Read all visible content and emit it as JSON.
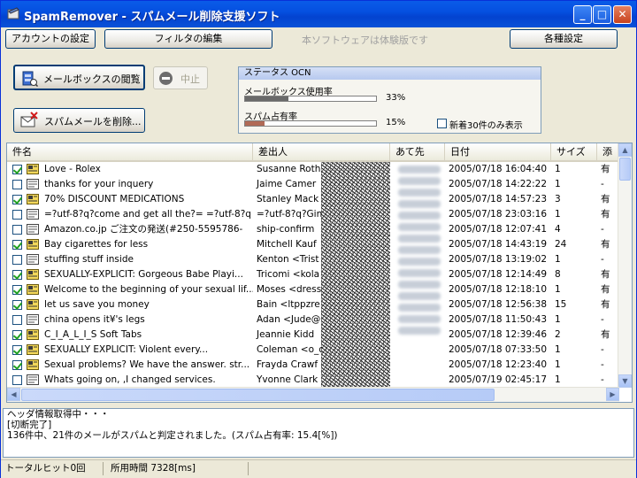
{
  "window": {
    "title": "SpamRemover - スパムメール削除支援ソフト"
  },
  "toolbar": {
    "account_settings": "アカウントの設定",
    "filter_edit": "フィルタの編集",
    "trial_note": "本ソフトウェアは体験版です",
    "settings": "各種設定",
    "browse_mailbox": "メールボックスの閲覧",
    "stop": "中止",
    "delete_spam": "スパムメールを削除..."
  },
  "status": {
    "title": "ステータス OCN",
    "mailbox_usage_label": "メールボックス使用率",
    "mailbox_usage_pct": "33%",
    "mailbox_usage_value": 33,
    "spam_ratio_label": "スパム占有率",
    "spam_ratio_pct": "15%",
    "spam_ratio_value": 15,
    "latest_only_label": "新着30件のみ表示"
  },
  "table": {
    "columns": [
      "件名",
      "差出人",
      "あて先",
      "日付",
      "サイズ",
      "添"
    ],
    "rows": [
      {
        "checked": true,
        "spam": true,
        "subject": "Love - Rolex",
        "sender": "Susanne Roth",
        "date": "2005/07/18 16:04:40",
        "size": "1",
        "att": "有"
      },
      {
        "checked": false,
        "spam": false,
        "subject": "thanks for your inquery",
        "sender": "Jaime Camer",
        "date": "2005/07/18 14:22:22",
        "size": "1",
        "att": "-"
      },
      {
        "checked": true,
        "spam": true,
        "subject": "70% DISCOUNT MEDICATIONS",
        "sender": "Stanley Mack",
        "date": "2005/07/18 14:57:23",
        "size": "3",
        "att": "有"
      },
      {
        "checked": false,
        "spam": false,
        "subject": "=?utf-8?q?come and get all the?= =?utf-8?q",
        "sender": "=?utf-8?q?Gin",
        "date": "2005/07/18 23:03:16",
        "size": "1",
        "att": "有"
      },
      {
        "checked": false,
        "spam": false,
        "subject": "Amazon.co.jp ご注文の発送(#250-5595786-",
        "sender": "ship-confirm",
        "date": "2005/07/18 12:07:41",
        "size": "4",
        "att": "-"
      },
      {
        "checked": true,
        "spam": true,
        "subject": "Bay cigarettes for less",
        "sender": "Mitchell Kauf",
        "date": "2005/07/18 14:43:19",
        "size": "24",
        "att": "有"
      },
      {
        "checked": false,
        "spam": false,
        "subject": "stuffing stuff inside",
        "sender": "Kenton <Trist",
        "date": "2005/07/18 13:19:02",
        "size": "1",
        "att": "-"
      },
      {
        "checked": true,
        "spam": true,
        "subject": "SEXUALLY-EXPLICIT: Gorgeous Babe Playi...",
        "sender": "Tricomi <kola",
        "date": "2005/07/18 12:14:49",
        "size": "8",
        "att": "有"
      },
      {
        "checked": true,
        "spam": true,
        "subject": "Welcome to the beginning of your sexual lif...",
        "sender": "Moses <dress",
        "date": "2005/07/18 12:18:10",
        "size": "1",
        "att": "有"
      },
      {
        "checked": true,
        "spam": true,
        "subject": "let us save you money",
        "sender": "Bain <ltppzre",
        "date": "2005/07/18 12:56:38",
        "size": "15",
        "att": "有"
      },
      {
        "checked": false,
        "spam": false,
        "subject": "china opens it¥'s legs",
        "sender": "Adan <Jude@",
        "date": "2005/07/18 11:50:43",
        "size": "1",
        "att": "-"
      },
      {
        "checked": true,
        "spam": true,
        "subject": "C_I_A_L_I_S Soft Tabs",
        "sender": "Jeannie Kidd",
        "date": "2005/07/18 12:39:46",
        "size": "2",
        "att": "有"
      },
      {
        "checked": true,
        "spam": true,
        "subject": "SEXUALLY EXPLICIT:          Violent every...",
        "sender": "Coleman <o_c",
        "date": "2005/07/18 07:33:50",
        "size": "1",
        "att": "-"
      },
      {
        "checked": true,
        "spam": true,
        "subject": "Sexual problems?  We have the answer. str...",
        "sender": "Frayda Crawf",
        "date": "2005/07/18 12:23:40",
        "size": "1",
        "att": "-"
      },
      {
        "checked": false,
        "spam": false,
        "subject": "Whats going on, ,I changed services.",
        "sender": "Yvonne Clark",
        "date": "2005/07/19 02:45:17",
        "size": "1",
        "att": "-"
      }
    ]
  },
  "log": {
    "lines": [
      "ヘッダ情報取得中・・・",
      "[切断完了]",
      "136件中、21件のメールがスパムと判定されました。(スパム占有率: 15.4[%])"
    ]
  },
  "statusbar": {
    "hits": "トータルヒット0回",
    "elapsed": "所用時間 7328[ms]"
  }
}
